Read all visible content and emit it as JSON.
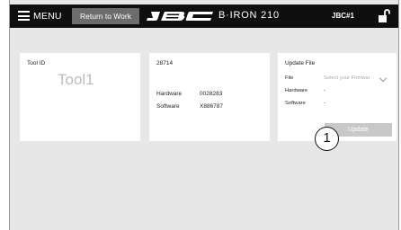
{
  "topbar": {
    "menu_label": "MENU",
    "return_button": "Return to Work",
    "brand_icon": "jbc-logo",
    "model": "B·IRON 210",
    "station": "JBC#1",
    "lock_icon": "unlock-icon"
  },
  "tool_card": {
    "title": "Tool ID",
    "tool_name": "Tool1"
  },
  "serial_card": {
    "serial": "28714",
    "hardware_label": "Hardware",
    "hardware_value": "0028283",
    "software_label": "Software",
    "software_value": "X886787"
  },
  "update_card": {
    "title": "Update File",
    "file_label": "File",
    "file_placeholder": "Select your Firmwar",
    "hardware_label": "Hardware",
    "hardware_value": "-",
    "software_label": "Software",
    "software_value": "-",
    "update_button": "Update"
  },
  "callout_number": "1",
  "colors": {
    "topbar_bg": "#0f0f0f",
    "button_bg": "#6c6c6c",
    "screen_bg": "#e7e7e7",
    "disabled_button": "#c8c8c8"
  }
}
